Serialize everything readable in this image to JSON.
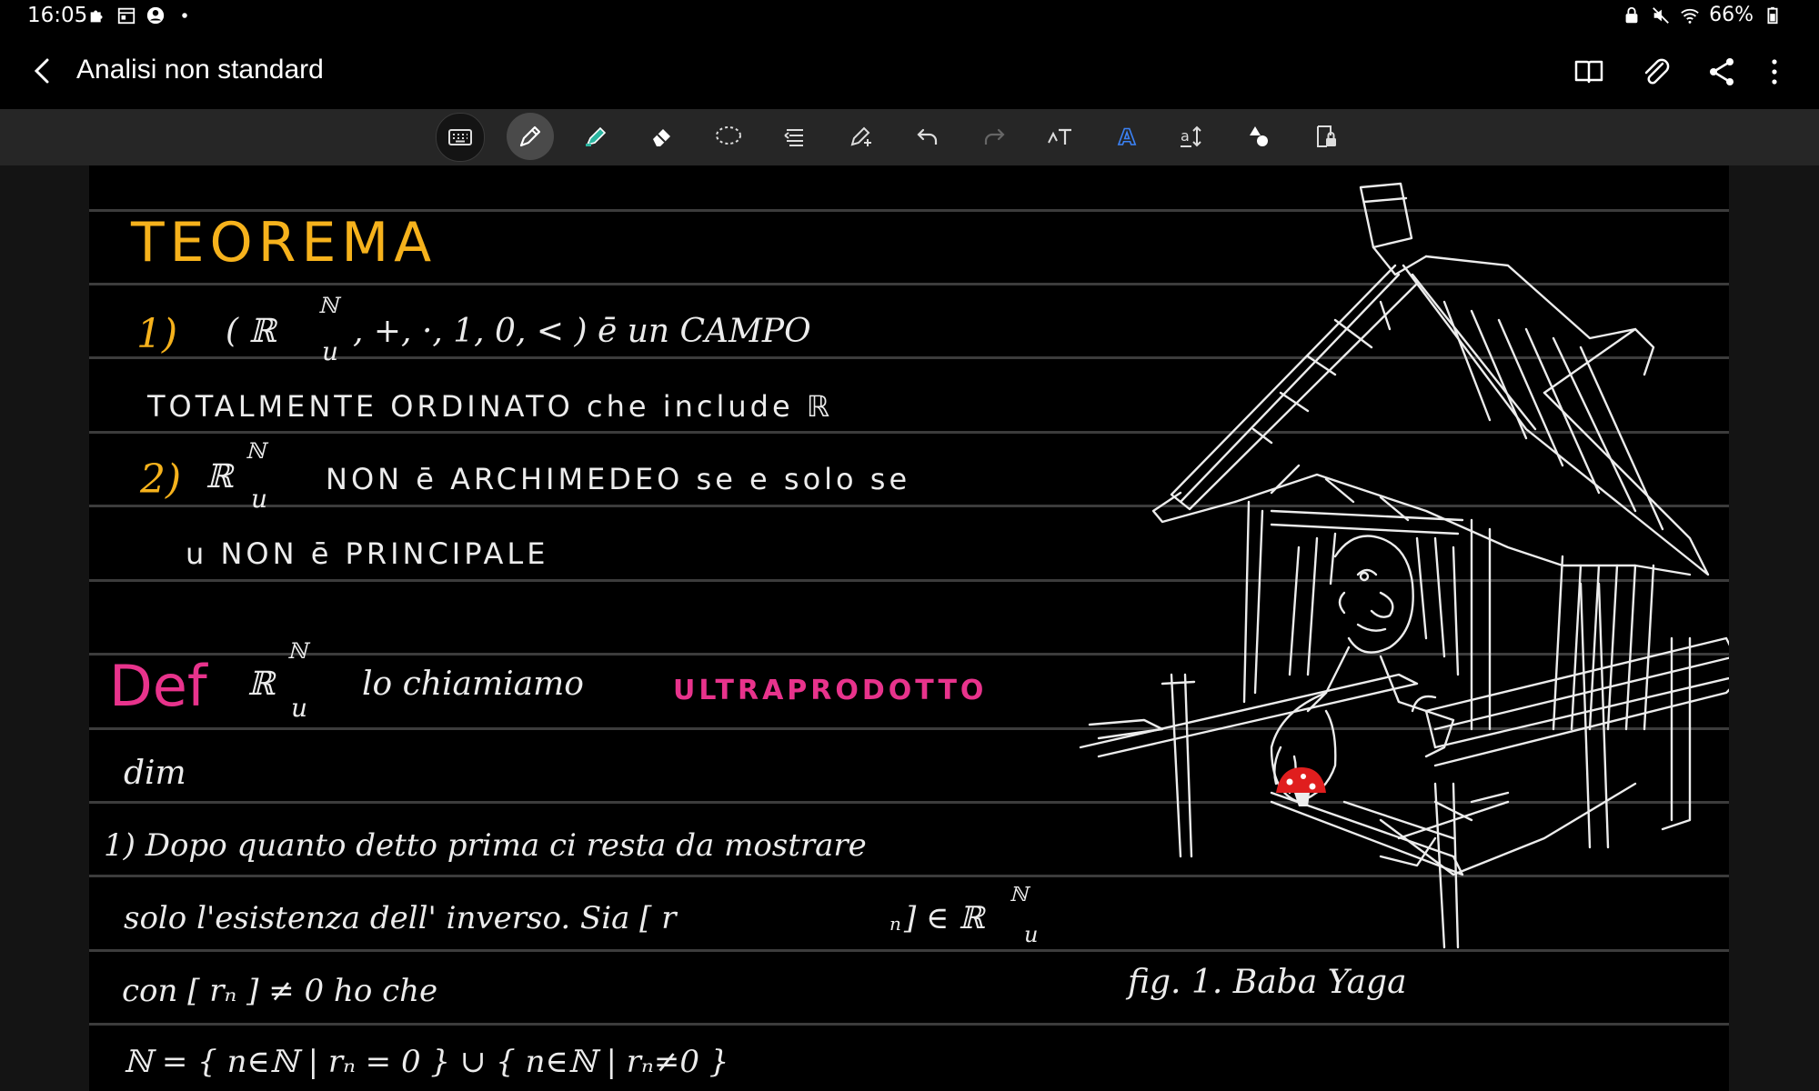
{
  "status_bar": {
    "time": "16:05",
    "battery": "66%",
    "left_icons": [
      "puzzle-icon",
      "calendar-icon",
      "account-icon",
      "dot-icon"
    ],
    "right_icons": [
      "lock-icon",
      "mute-icon",
      "wifi-icon",
      "battery-icon"
    ]
  },
  "header": {
    "title": "Analisi non standard",
    "actions": [
      "book-icon",
      "attach-icon",
      "share-icon",
      "more-icon"
    ]
  },
  "toolbar": {
    "tools": [
      "keyboard-icon",
      "pen-icon",
      "highlighter-icon",
      "eraser-icon",
      "lasso-icon",
      "scroll-icon",
      "pen-settings-icon",
      "undo-icon",
      "redo-icon",
      "text-style-icon",
      "text-color-icon",
      "text-size-icon",
      "shapes-icon",
      "lock-page-icon"
    ],
    "active_tool": "pen-icon",
    "accent": "#3b82f6"
  },
  "colors": {
    "yellow": "#f6b21c",
    "pink": "#e8338c",
    "ink": "#ececec",
    "mushroom": "#e01e1e"
  },
  "note": {
    "theorem_heading": "TEOREMA",
    "t1_prefix": "1)",
    "t1_a": "( ℝ",
    "t1_sup": "ℕ",
    "t1_sub": "u",
    "t1_b": ", +, ·, 1, 0, < )   ē   un      CAMPO",
    "t1_line2": "TOTALMENTE   ORDINATO   che   include  ℝ",
    "t2_prefix": "2)",
    "t2_a": "ℝ",
    "t2_sup": "ℕ",
    "t2_sub": "u",
    "t2_b": "NON  ē  ARCHIMEDEO   se  e  solo  se",
    "t2_line2": "u      NON    ē    PRINCIPALE",
    "def_label": "Def",
    "def_a": "ℝ",
    "def_sup": "ℕ",
    "def_sub": "u",
    "def_b": "lo  chiamiamo",
    "def_term": "ULTRAPRODOTTO",
    "dim": "dim",
    "p1": "1)  Dopo  quanto  detto  prima   ci   resta  da   mostrare",
    "p2_a": "solo   l'esistenza   dell' inverso.   Sia   [ r",
    "p2_b": " ]  ∈  ℝ",
    "p2_sub_n": "n",
    "p2_sup": "ℕ",
    "p2_sub": "u",
    "p3": "con    [ rₙ ]  ≠ 0      ho   che",
    "p4": "ℕ = { n∈ℕ | rₙ = 0 }  ∪  { n∈ℕ | rₙ≠0 }",
    "caption": "fig. 1.    Baba    Yaga"
  }
}
